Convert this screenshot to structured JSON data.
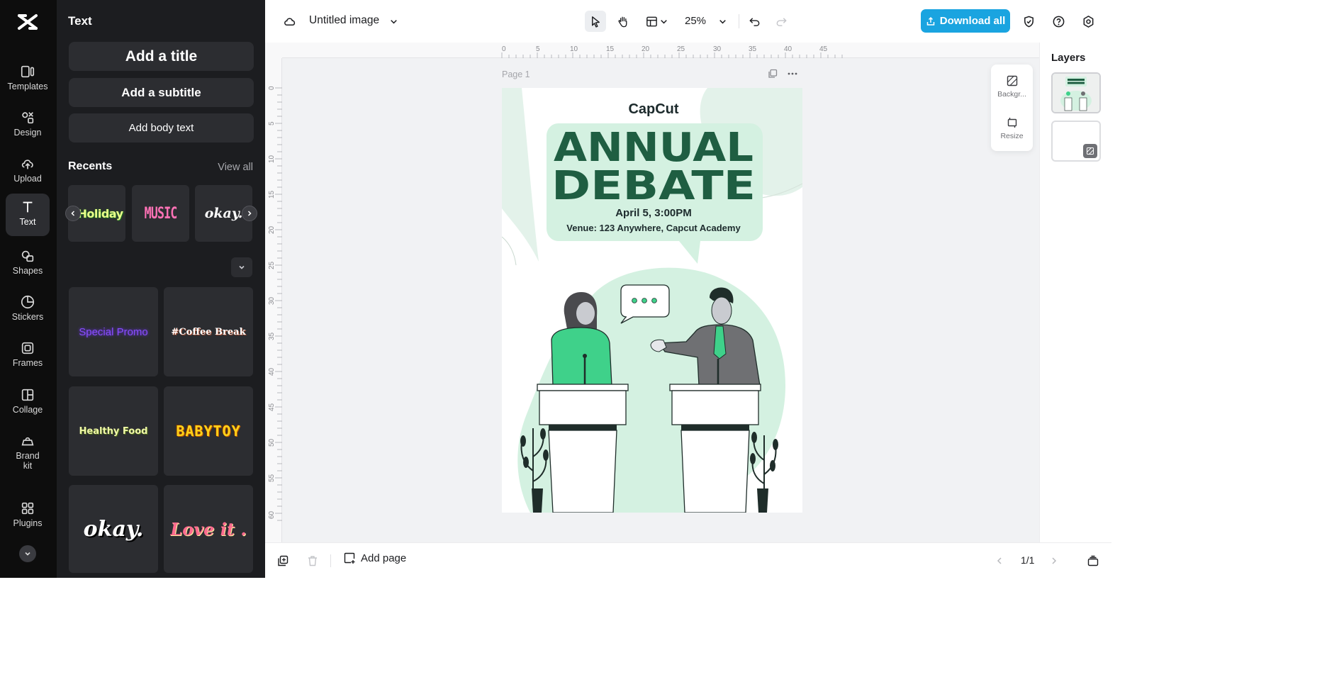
{
  "app": {
    "title": "Untitled image",
    "zoom": "25%",
    "download_label": "Download all"
  },
  "rail": {
    "items": [
      {
        "label": "Templates",
        "icon": "templates-icon"
      },
      {
        "label": "Design",
        "icon": "design-icon"
      },
      {
        "label": "Upload",
        "icon": "upload-icon"
      },
      {
        "label": "Text",
        "icon": "text-icon",
        "active": true
      },
      {
        "label": "Shapes",
        "icon": "shapes-icon"
      },
      {
        "label": "Stickers",
        "icon": "stickers-icon"
      },
      {
        "label": "Frames",
        "icon": "frames-icon"
      },
      {
        "label": "Collage",
        "icon": "collage-icon"
      },
      {
        "label": "Brand kit",
        "icon": "brand-kit-icon"
      },
      {
        "label": "Plugins",
        "icon": "plugins-icon"
      }
    ]
  },
  "panel": {
    "title": "Text",
    "add_title": "Add a title",
    "add_subtitle": "Add a subtitle",
    "add_body": "Add body text",
    "recents_heading": "Recents",
    "view_all": "View all",
    "recents": [
      "Holiday",
      "MUSIC",
      "okay."
    ],
    "presets": [
      "Special Promo",
      "#Coffee Break",
      "Healthy Food",
      "BABYTOY",
      "okay.",
      "Love it ."
    ]
  },
  "canvas": {
    "page_label": "Page 1",
    "ruler_h": [
      "0",
      "5",
      "10",
      "15",
      "20",
      "25",
      "30",
      "35",
      "40",
      "45"
    ],
    "ruler_v": [
      "0",
      "5",
      "10",
      "15",
      "20",
      "25",
      "30",
      "35",
      "40",
      "45",
      "50",
      "55",
      "60"
    ],
    "poster": {
      "brand": "CapCut",
      "line1": "ANNUAL",
      "line2": "DEBATE",
      "date": "April 5,  3:00PM",
      "venue": "Venue: 123 Anywhere, Capcut Academy",
      "colors": {
        "dark_green": "#1f5e42",
        "mint": "#d4f1e1",
        "light_mint": "#e3f2ea",
        "accent_green": "#3fd18a"
      }
    },
    "floating_tools": [
      "Backgr...",
      "Resize"
    ]
  },
  "layers": {
    "heading": "Layers"
  },
  "bottom": {
    "add_page": "Add page",
    "pager": "1/1"
  }
}
